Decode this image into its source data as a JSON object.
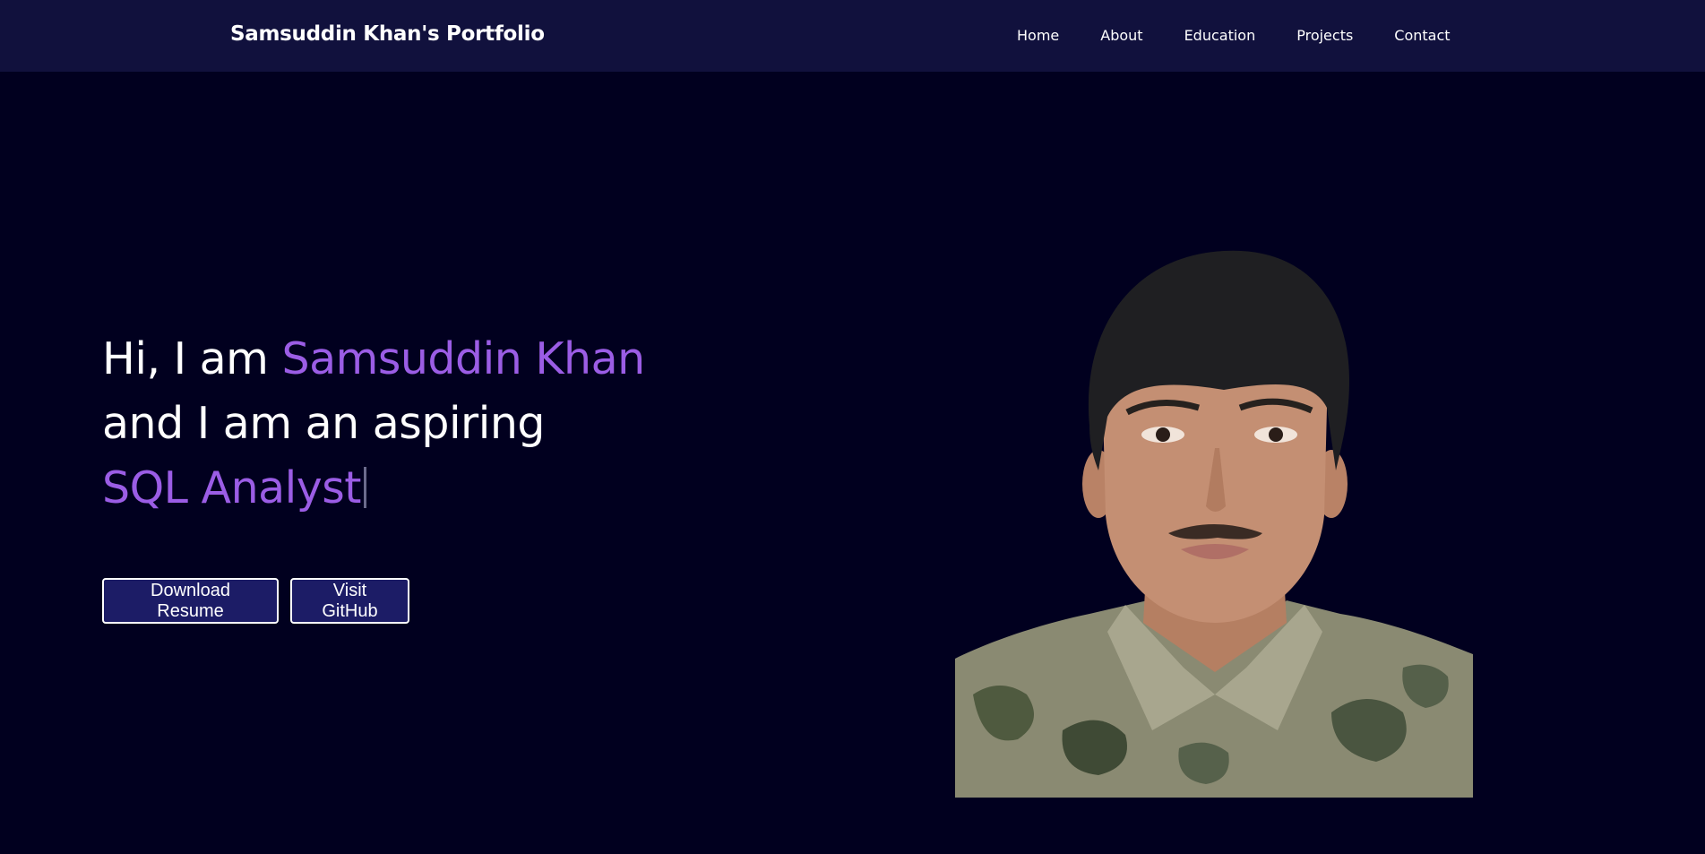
{
  "header": {
    "brand": "Samsuddin Khan's Portfolio",
    "nav": [
      "Home",
      "About",
      "Education",
      "Projects",
      "Contact"
    ]
  },
  "hero": {
    "greeting": "Hi, I am ",
    "name": "Samsuddin Khan",
    "line2": "and I am an aspiring",
    "role": "SQL Analyst",
    "buttons": {
      "resume": "Download Resume",
      "github": "Visit GitHub"
    }
  },
  "colors": {
    "background": "#01001f",
    "navbar": "#11113d",
    "accent": "#9b5de5",
    "button": "#1c1c66"
  },
  "icons": {
    "profile_photo": "profile-photo"
  }
}
